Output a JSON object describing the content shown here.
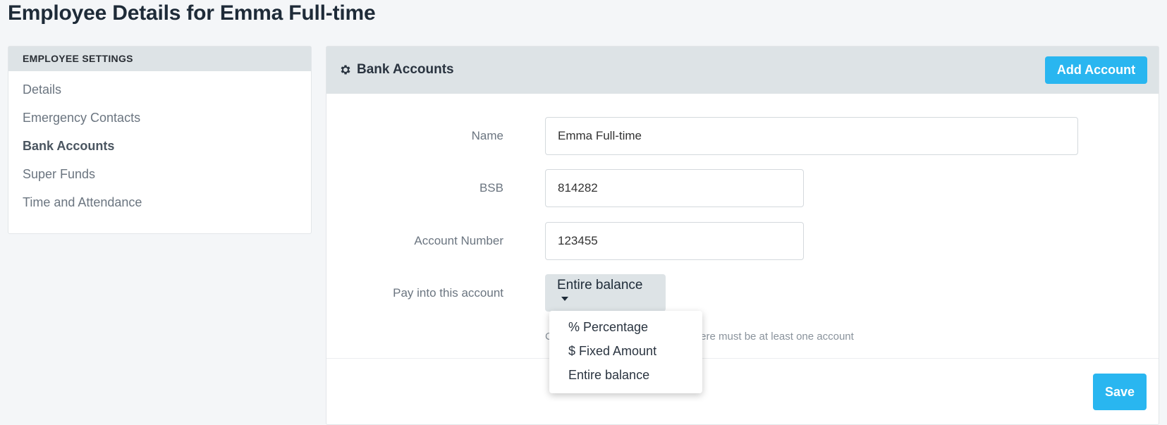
{
  "page": {
    "title": "Employee Details for Emma Full-time"
  },
  "sidebar": {
    "header": "EMPLOYEE SETTINGS",
    "items": [
      {
        "label": "Details"
      },
      {
        "label": "Emergency Contacts"
      },
      {
        "label": "Bank Accounts",
        "active": true
      },
      {
        "label": "Super Funds"
      },
      {
        "label": "Time and Attendance"
      }
    ]
  },
  "panel": {
    "title": "Bank Accounts",
    "icon": "gear-icon",
    "add_label": "Add Account",
    "save_label": "Save"
  },
  "form": {
    "name_label": "Name",
    "name_value": "Emma Full-time",
    "bsb_label": "BSB",
    "bsb_value": "814282",
    "account_label": "Account Number",
    "account_value": "123455",
    "pay_label": "Pay into this account",
    "pay_value": "Entire balance",
    "help_prefix": "C",
    "help_suffix": "here must be at least one account"
  },
  "dropdown": {
    "options": [
      {
        "label": "% Percentage"
      },
      {
        "label": "$ Fixed Amount"
      },
      {
        "label": "Entire balance"
      }
    ]
  },
  "colors": {
    "accent": "#29b6f0",
    "header_bg": "#dde3e6",
    "title": "#1e2b38"
  }
}
